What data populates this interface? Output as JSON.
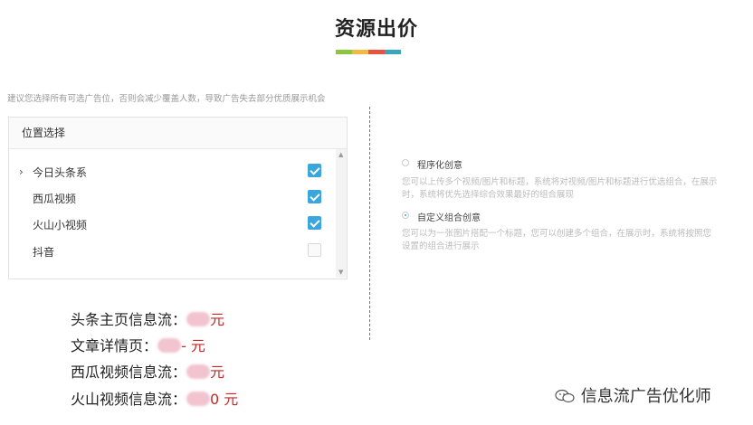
{
  "page": {
    "title": "资源出价"
  },
  "title_bar_colors": [
    "#8cc63f",
    "#f4b942",
    "#e8533f",
    "#3aa6b9"
  ],
  "hint": "建议您选择所有可选广告位，否则会减少覆盖人数，导致广告失去部分优质展示机会",
  "placement": {
    "header": "位置选择",
    "items": [
      {
        "label": "今日头条系",
        "arrow": "›",
        "checked": true
      },
      {
        "label": "西瓜视频",
        "checked": true
      },
      {
        "label": "火山小视频",
        "checked": true
      },
      {
        "label": "抖音",
        "checked": false
      }
    ]
  },
  "creative": {
    "option1": "程序化创意",
    "desc1": "您可以上传多个视频/图片和标题，系统将对视频/图片和标题进行优选组合，在展示时，系统将优先选择综合效果最好的组合展现",
    "option2": "自定义组合创意",
    "desc2": "您可以为一张图片搭配一个标题，您可以创建多个组合，在展示时，系统将按照您设置的组合进行展示",
    "selected": "自定义组合创意"
  },
  "prices": [
    {
      "label": "头条主页信息流：",
      "value": "元"
    },
    {
      "label": "文章详情页：",
      "value": "-  元"
    },
    {
      "label": "西瓜视频信息流：",
      "value": "元"
    },
    {
      "label": "火山视频信息流：",
      "value": "0  元"
    }
  ],
  "watermark": {
    "text": "信息流广告优化师",
    "icon": "wechat-icon"
  }
}
